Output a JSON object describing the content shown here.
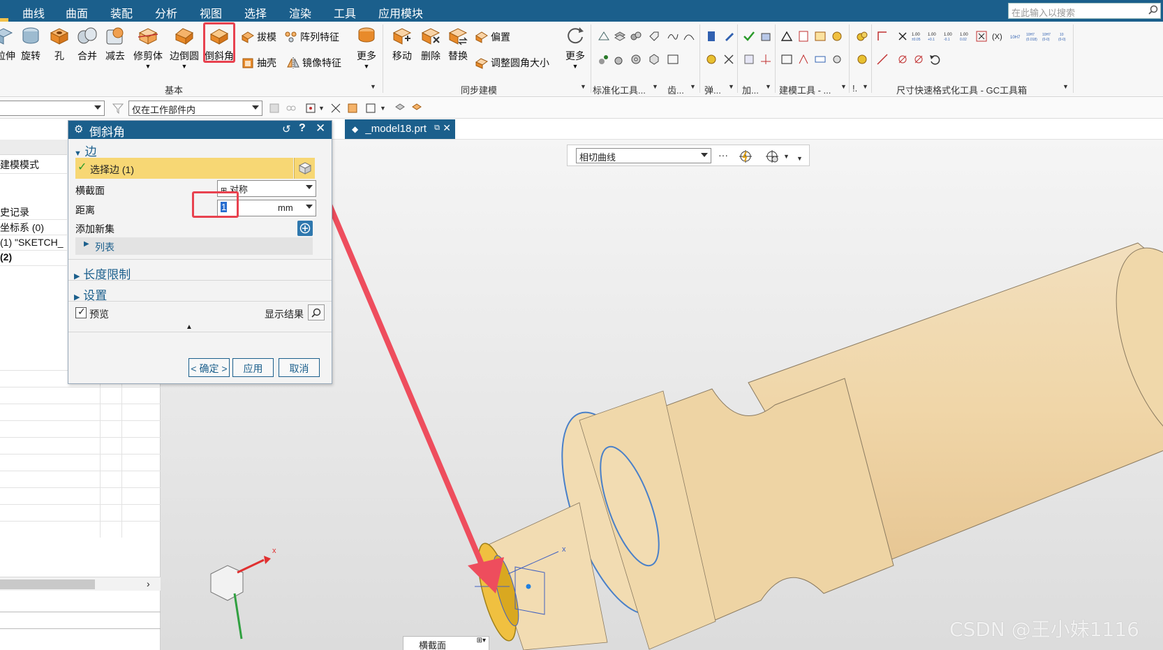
{
  "menu": {
    "items": [
      "曲线",
      "曲面",
      "装配",
      "分析",
      "视图",
      "选择",
      "渲染",
      "工具",
      "应用模块"
    ],
    "search_placeholder": "在此输入以搜索"
  },
  "ribbon": {
    "basic": {
      "buttons": [
        "拉伸",
        "旋转",
        "孔",
        "合并",
        "减去",
        "修剪体",
        "边倒圆",
        "倒斜角"
      ],
      "small": [
        "拔模",
        "阵列特征",
        "抽壳",
        "镜像特征"
      ],
      "more": "更多",
      "group_label": "基本"
    },
    "sync": {
      "buttons": [
        "移动",
        "删除",
        "替换"
      ],
      "small": [
        "偏置",
        "调整圆角大小"
      ],
      "more": "更多",
      "group_label": "同步建模"
    },
    "group_labels": [
      "标准化工具...",
      "齿...",
      "弹...",
      "加...",
      "建模工具 - ...",
      "!.",
      "尺寸快速格式化工具 - GC工具箱"
    ]
  },
  "toolbar2": {
    "filter_value": "",
    "scope_value": "仅在工作部件内"
  },
  "document_tab": "_model18.prt",
  "selection_bar": {
    "curve_rule": "相切曲线"
  },
  "navigator": {
    "rows": [
      "建模模式",
      "史记录",
      "坐标系 (0)",
      "(1) \"SKETCH_",
      "(2)"
    ]
  },
  "dialog": {
    "title": "倒斜角",
    "section_edge": "边",
    "select_edge": "选择边 (1)",
    "cross_section_label": "横截面",
    "cross_section_value": "对称",
    "distance_label": "距离",
    "distance_value": "1",
    "distance_unit": "mm",
    "add_new_set": "添加新集",
    "list_label": "列表",
    "length_limit": "长度限制",
    "settings": "设置",
    "preview": "预览",
    "show_result": "显示结果",
    "ok": "< 确定 >",
    "apply": "应用",
    "cancel": "取消"
  },
  "mini_panel": {
    "label": "横截面"
  },
  "watermark": "CSDN @王小妹1116",
  "colors": {
    "brand": "#1b5f8c",
    "highlight": "#e8424f",
    "model": "#f2d9b0",
    "selected_edge": "#f0c040"
  }
}
